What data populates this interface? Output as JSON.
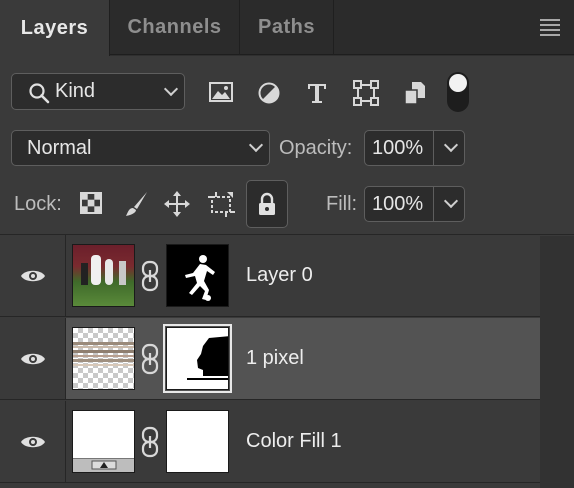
{
  "tabs": [
    {
      "label": "Layers",
      "active": true
    },
    {
      "label": "Channels",
      "active": false
    },
    {
      "label": "Paths",
      "active": false
    }
  ],
  "filter": {
    "kind_label": "Kind",
    "icons": [
      "image-filter-icon",
      "adjustment-filter-icon",
      "type-filter-icon",
      "shape-filter-icon",
      "smart-object-filter-icon",
      "filter-toggle"
    ]
  },
  "blend": {
    "mode": "Normal",
    "opacity_label": "Opacity:",
    "opacity_value": "100%"
  },
  "lock": {
    "label": "Lock:",
    "fill_label": "Fill:",
    "fill_value": "100%"
  },
  "layers": [
    {
      "name": "Layer 0",
      "selected": false
    },
    {
      "name": "1 pixel",
      "selected": true
    },
    {
      "name": "Color Fill 1",
      "selected": false
    }
  ],
  "colors": {
    "panel_bg": "#3a3a3a",
    "selected_row": "#535353",
    "tab_bar": "#2b2b2b"
  }
}
